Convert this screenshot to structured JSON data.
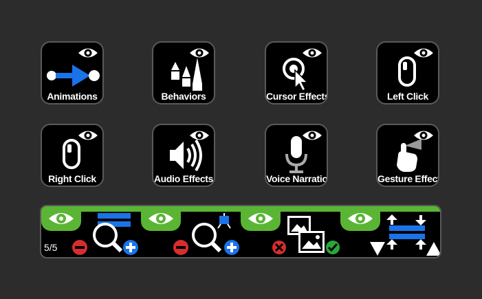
{
  "tiles": [
    {
      "label": "Animations",
      "icon": "animation-path-icon"
    },
    {
      "label": "Behaviors",
      "icon": "behaviors-shapes-icon"
    },
    {
      "label": "Cursor Effects",
      "icon": "cursor-click-icon"
    },
    {
      "label": "Left Click",
      "icon": "mouse-left-click-icon"
    },
    {
      "label": "Right Click",
      "icon": "mouse-right-click-icon"
    },
    {
      "label": "Audio Effects",
      "icon": "speaker-icon"
    },
    {
      "label": "Voice Narration",
      "icon": "microphone-icon"
    },
    {
      "label": "Gesture Effects",
      "icon": "tap-gesture-icon"
    }
  ],
  "toolbar": {
    "page_indicator": "5/5",
    "tools": [
      {
        "name": "zoom-n-pan",
        "icon": "zoom-lines-icon"
      },
      {
        "name": "scale-to-fit",
        "icon": "zoom-canvas-icon"
      },
      {
        "name": "media-replace",
        "icon": "images-icon"
      },
      {
        "name": "expand-contract",
        "icon": "expand-contract-icon"
      }
    ]
  },
  "colors": {
    "accent_green": "#5ab535",
    "accent_blue": "#1a73e8",
    "minus_red": "#d62e2e",
    "check_green": "#2aa63a",
    "tile_bg": "#000000",
    "page_bg": "#2c2c2c"
  }
}
